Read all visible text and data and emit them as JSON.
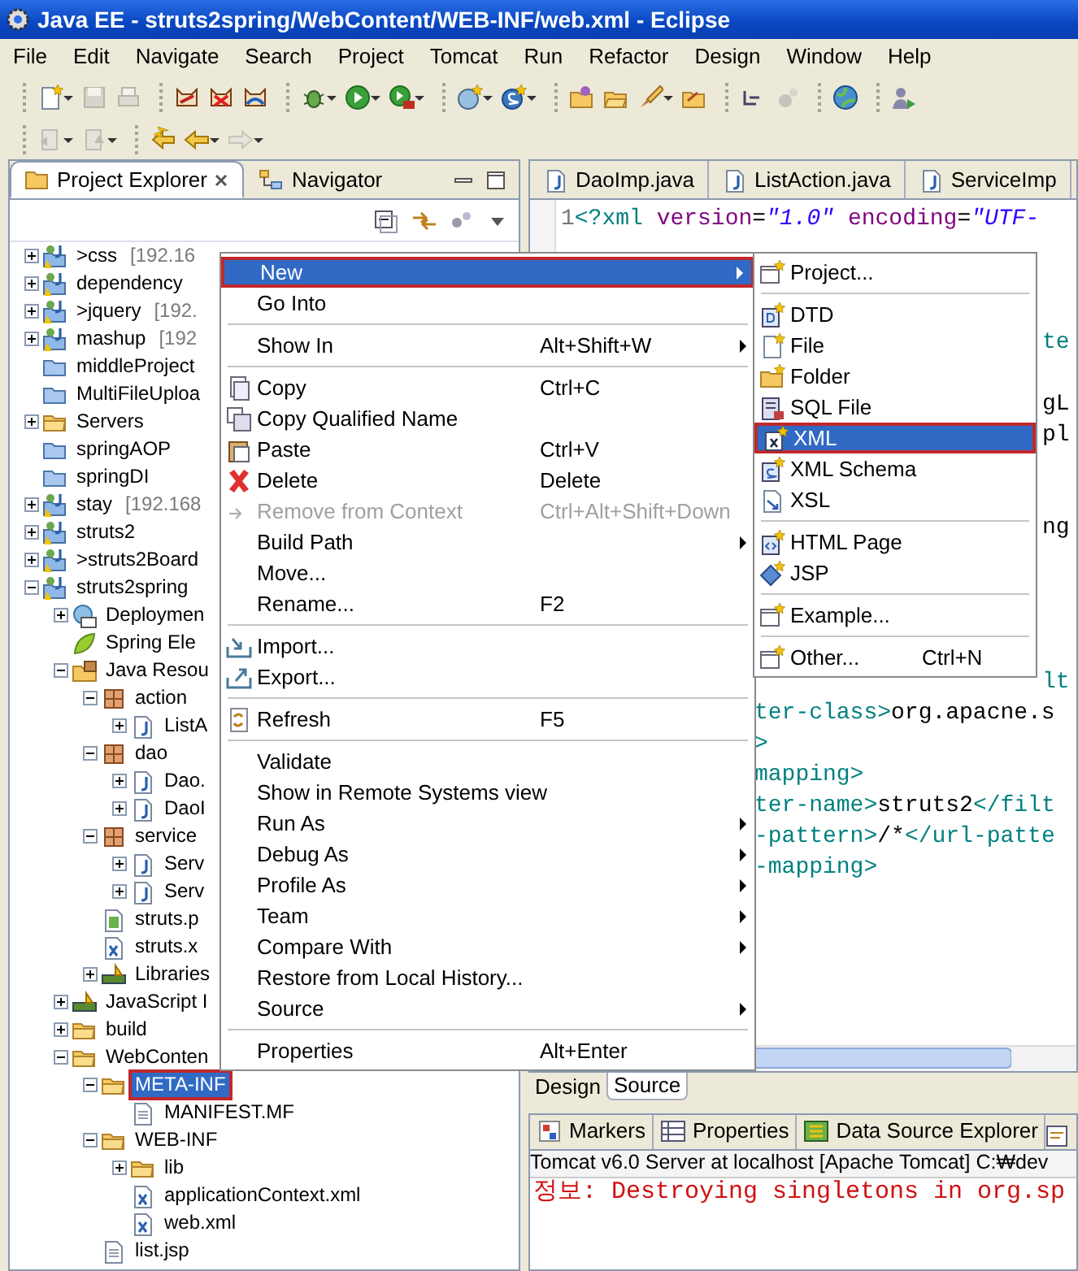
{
  "window": {
    "title": "Java EE - struts2spring/WebContent/WEB-INF/web.xml - Eclipse"
  },
  "menu_bar": [
    "File",
    "Edit",
    "Navigate",
    "Search",
    "Project",
    "Tomcat",
    "Run",
    "Refactor",
    "Design",
    "Window",
    "Help"
  ],
  "project_explorer": {
    "tabs": [
      {
        "label": "Project Explorer",
        "selected": true
      },
      {
        "label": "Navigator",
        "selected": false
      }
    ],
    "tree": [
      {
        "label": ">css",
        "decoration": "[192.16",
        "kind": "project",
        "expanded": false,
        "selected": false
      },
      {
        "label": "dependency",
        "kind": "project",
        "expanded": false,
        "selected": false
      },
      {
        "label": ">jquery",
        "decoration": "[192.",
        "kind": "project",
        "expanded": false,
        "selected": false
      },
      {
        "label": "mashup",
        "decoration": "[192",
        "kind": "project",
        "expanded": false,
        "selected": false
      },
      {
        "label": "middleProject",
        "kind": "plain-project",
        "selected": false
      },
      {
        "label": "MultiFileUploa",
        "kind": "plain-project",
        "selected": false
      },
      {
        "label": "Servers",
        "kind": "folder",
        "expanded": false,
        "selected": false
      },
      {
        "label": "springAOP",
        "kind": "plain-project",
        "selected": false
      },
      {
        "label": "springDI",
        "kind": "plain-project",
        "selected": false
      },
      {
        "label": "stay",
        "decoration": "[192.168",
        "kind": "project",
        "expanded": false,
        "selected": false
      },
      {
        "label": "struts2",
        "kind": "project",
        "expanded": false,
        "selected": false
      },
      {
        "label": ">struts2Board",
        "kind": "project",
        "expanded": false,
        "selected": false
      },
      {
        "label": "struts2spring",
        "kind": "project",
        "expanded": true,
        "selected": false,
        "children": [
          {
            "label": "Deploymen",
            "kind": "deployment",
            "expanded": false,
            "selected": false
          },
          {
            "label": "Spring Ele",
            "kind": "spring",
            "selected": false
          },
          {
            "label": "Java Resou",
            "kind": "source",
            "expanded": true,
            "selected": false,
            "children": [
              {
                "label": "action",
                "kind": "package",
                "expanded": true,
                "selected": false,
                "children": [
                  {
                    "label": "ListA",
                    "kind": "java",
                    "expanded": false,
                    "selected": false
                  }
                ]
              },
              {
                "label": "dao",
                "kind": "package",
                "expanded": true,
                "selected": false,
                "children": [
                  {
                    "label": "Dao.",
                    "kind": "java",
                    "expanded": false,
                    "selected": false
                  },
                  {
                    "label": "DaoI",
                    "kind": "java",
                    "expanded": false,
                    "selected": false
                  }
                ]
              },
              {
                "label": "service",
                "kind": "package",
                "expanded": true,
                "selected": false,
                "children": [
                  {
                    "label": "Serv",
                    "kind": "java",
                    "expanded": false,
                    "selected": false
                  },
                  {
                    "label": "Serv",
                    "kind": "java",
                    "expanded": false,
                    "selected": false
                  }
                ]
              },
              {
                "label": "struts.p",
                "kind": "properties",
                "selected": false
              },
              {
                "label": "struts.x",
                "kind": "xml",
                "selected": false
              },
              {
                "label": "Libraries",
                "kind": "library",
                "expanded": false,
                "selected": false
              }
            ]
          },
          {
            "label": "JavaScript I",
            "kind": "library",
            "expanded": false,
            "selected": false
          },
          {
            "label": "build",
            "kind": "folder",
            "expanded": false,
            "selected": false
          },
          {
            "label": "WebConten",
            "kind": "folder",
            "expanded": true,
            "selected": false,
            "children": [
              {
                "label": "META-INF",
                "kind": "folder",
                "expanded": true,
                "selected": true,
                "marked": true,
                "children": [
                  {
                    "label": "MANIFEST.MF",
                    "kind": "file",
                    "selected": false
                  }
                ]
              },
              {
                "label": "WEB-INF",
                "kind": "folder",
                "expanded": true,
                "selected": false,
                "children": [
                  {
                    "label": "lib",
                    "kind": "folder",
                    "expanded": false,
                    "selected": false
                  },
                  {
                    "label": "applicationContext.xml",
                    "kind": "xml",
                    "selected": false
                  },
                  {
                    "label": "web.xml",
                    "kind": "xml",
                    "selected": false
                  }
                ]
              },
              {
                "label": "list.jsp",
                "kind": "file",
                "selected": false
              }
            ]
          }
        ]
      }
    ]
  },
  "editor": {
    "tabs": [
      {
        "label": "DaoImp.java",
        "selected": false
      },
      {
        "label": "ListAction.java",
        "selected": false
      },
      {
        "label": "ServiceImp",
        "selected": false
      }
    ],
    "lines": [
      {
        "kind": "start",
        "number": "1",
        "parts": [
          {
            "text": "<?xml",
            "kind": "tag"
          },
          {
            "text": " version",
            "kind": "attr"
          },
          {
            "text": "=",
            "kind": "text"
          },
          {
            "text": "\"1.0\"",
            "kind": "value"
          },
          {
            "text": " encoding",
            "kind": "attr"
          },
          {
            "text": "=",
            "kind": "text"
          },
          {
            "text": "\"UTF-",
            "kind": "value"
          }
        ]
      },
      {
        "kind": "blank"
      },
      {
        "kind": "blank"
      },
      {
        "kind": "blank"
      },
      {
        "kind": "edge",
        "parts": [
          {
            "text": "te",
            "kind": "tag"
          }
        ]
      },
      {
        "kind": "blank"
      },
      {
        "kind": "edge",
        "parts": [
          {
            "text": "gL",
            "kind": "text"
          }
        ]
      },
      {
        "kind": "edge",
        "parts": [
          {
            "text": "pl",
            "kind": "text"
          }
        ]
      },
      {
        "kind": "blank"
      },
      {
        "kind": "blank"
      },
      {
        "kind": "edge",
        "parts": [
          {
            "text": "ng",
            "kind": "text"
          }
        ]
      },
      {
        "kind": "blank"
      },
      {
        "kind": "blank"
      },
      {
        "kind": "blank"
      },
      {
        "kind": "blank"
      },
      {
        "kind": "edge",
        "parts": [
          {
            "text": "lt",
            "kind": "tag"
          }
        ]
      },
      {
        "kind": "mid",
        "parts": [
          {
            "text": "ter-class>",
            "kind": "tag"
          },
          {
            "text": "org.apacne.s",
            "kind": "text"
          }
        ]
      },
      {
        "kind": "mid",
        "parts": [
          {
            "text": ">",
            "kind": "tag"
          }
        ]
      },
      {
        "kind": "mid",
        "parts": [
          {
            "text": "mapping>",
            "kind": "tag"
          }
        ]
      },
      {
        "kind": "mid",
        "parts": [
          {
            "text": "ter-name>",
            "kind": "tag"
          },
          {
            "text": "struts2",
            "kind": "text"
          },
          {
            "text": "</filt",
            "kind": "tag"
          }
        ]
      },
      {
        "kind": "mid",
        "parts": [
          {
            "text": "-pattern>",
            "kind": "tag"
          },
          {
            "text": "/*",
            "kind": "text"
          },
          {
            "text": "</url-patte",
            "kind": "tag"
          }
        ]
      },
      {
        "kind": "mid",
        "parts": [
          {
            "text": "-mapping>",
            "kind": "tag"
          }
        ]
      }
    ],
    "view_tabs": [
      {
        "label": "Design",
        "selected": false
      },
      {
        "label": "Source",
        "selected": true
      }
    ]
  },
  "bottom_panel": {
    "tabs": [
      {
        "label": "Markers",
        "selected": false
      },
      {
        "label": "Properties",
        "selected": false
      },
      {
        "label": "Data Source Explorer",
        "selected": false
      }
    ],
    "console": {
      "header": "Tomcat v6.0 Server at localhost [Apache Tomcat] C:₩dev",
      "lines": [
        {
          "text": "정보: Destroying singletons in org.sp",
          "kind": "error"
        }
      ]
    }
  },
  "context_menu": {
    "items": [
      {
        "kind": "item",
        "label": "New",
        "submenu": true,
        "selected": true,
        "marked": true,
        "disabled": false
      },
      {
        "kind": "item",
        "label": "Go Into",
        "submenu": false,
        "selected": false,
        "disabled": false
      },
      {
        "kind": "separator"
      },
      {
        "kind": "item",
        "label": "Show In",
        "shortcut": "Alt+Shift+W",
        "submenu": true,
        "selected": false,
        "disabled": false
      },
      {
        "kind": "separator"
      },
      {
        "kind": "item",
        "label": "Copy",
        "shortcut": "Ctrl+C",
        "submenu": false,
        "selected": false,
        "disabled": false
      },
      {
        "kind": "item",
        "label": "Copy Qualified Name",
        "submenu": false,
        "selected": false,
        "disabled": false
      },
      {
        "kind": "item",
        "label": "Paste",
        "shortcut": "Ctrl+V",
        "submenu": false,
        "selected": false,
        "disabled": false
      },
      {
        "kind": "item",
        "label": "Delete",
        "shortcut": "Delete",
        "submenu": false,
        "selected": false,
        "disabled": false
      },
      {
        "kind": "item",
        "label": "Remove from Context",
        "shortcut": "Ctrl+Alt+Shift+Down",
        "submenu": false,
        "selected": false,
        "disabled": true
      },
      {
        "kind": "item",
        "label": "Build Path",
        "submenu": true,
        "selected": false,
        "disabled": false
      },
      {
        "kind": "item",
        "label": "Move...",
        "submenu": false,
        "selected": false,
        "disabled": false
      },
      {
        "kind": "item",
        "label": "Rename...",
        "shortcut": "F2",
        "submenu": false,
        "selected": false,
        "disabled": false
      },
      {
        "kind": "separator"
      },
      {
        "kind": "item",
        "label": "Import...",
        "submenu": false,
        "selected": false,
        "disabled": false
      },
      {
        "kind": "item",
        "label": "Export...",
        "submenu": false,
        "selected": false,
        "disabled": false
      },
      {
        "kind": "separator"
      },
      {
        "kind": "item",
        "label": "Refresh",
        "shortcut": "F5",
        "submenu": false,
        "selected": false,
        "disabled": false
      },
      {
        "kind": "separator"
      },
      {
        "kind": "item",
        "label": "Validate",
        "submenu": false,
        "selected": false,
        "disabled": false
      },
      {
        "kind": "item",
        "label": "Show in Remote Systems view",
        "submenu": false,
        "selected": false,
        "disabled": false
      },
      {
        "kind": "item",
        "label": "Run As",
        "submenu": true,
        "selected": false,
        "disabled": false
      },
      {
        "kind": "item",
        "label": "Debug As",
        "submenu": true,
        "selected": false,
        "disabled": false
      },
      {
        "kind": "item",
        "label": "Profile As",
        "submenu": true,
        "selected": false,
        "disabled": false
      },
      {
        "kind": "item",
        "label": "Team",
        "submenu": true,
        "selected": false,
        "disabled": false
      },
      {
        "kind": "item",
        "label": "Compare With",
        "submenu": true,
        "selected": false,
        "disabled": false
      },
      {
        "kind": "item",
        "label": "Restore from Local History...",
        "submenu": false,
        "selected": false,
        "disabled": false
      },
      {
        "kind": "item",
        "label": "Source",
        "submenu": true,
        "selected": false,
        "disabled": false
      },
      {
        "kind": "separator"
      },
      {
        "kind": "item",
        "label": "Properties",
        "shortcut": "Alt+Enter",
        "submenu": false,
        "selected": false,
        "disabled": false
      }
    ]
  },
  "submenu": {
    "items": [
      {
        "kind": "item",
        "label": "Project...",
        "selected": false
      },
      {
        "kind": "separator"
      },
      {
        "kind": "item",
        "label": "DTD",
        "selected": false
      },
      {
        "kind": "item",
        "label": "File",
        "selected": false
      },
      {
        "kind": "item",
        "label": "Folder",
        "selected": false
      },
      {
        "kind": "item",
        "label": "SQL File",
        "selected": false
      },
      {
        "kind": "item",
        "label": "XML",
        "selected": true,
        "marked": true
      },
      {
        "kind": "item",
        "label": "XML Schema",
        "selected": false
      },
      {
        "kind": "item",
        "label": "XSL",
        "selected": false
      },
      {
        "kind": "separator"
      },
      {
        "kind": "item",
        "label": "HTML Page",
        "selected": false
      },
      {
        "kind": "item",
        "label": "JSP",
        "selected": false
      },
      {
        "kind": "separator"
      },
      {
        "kind": "item",
        "label": "Example...",
        "selected": false
      },
      {
        "kind": "separator"
      },
      {
        "kind": "item",
        "label": "Other...",
        "shortcut": "Ctrl+N",
        "selected": false
      }
    ]
  }
}
